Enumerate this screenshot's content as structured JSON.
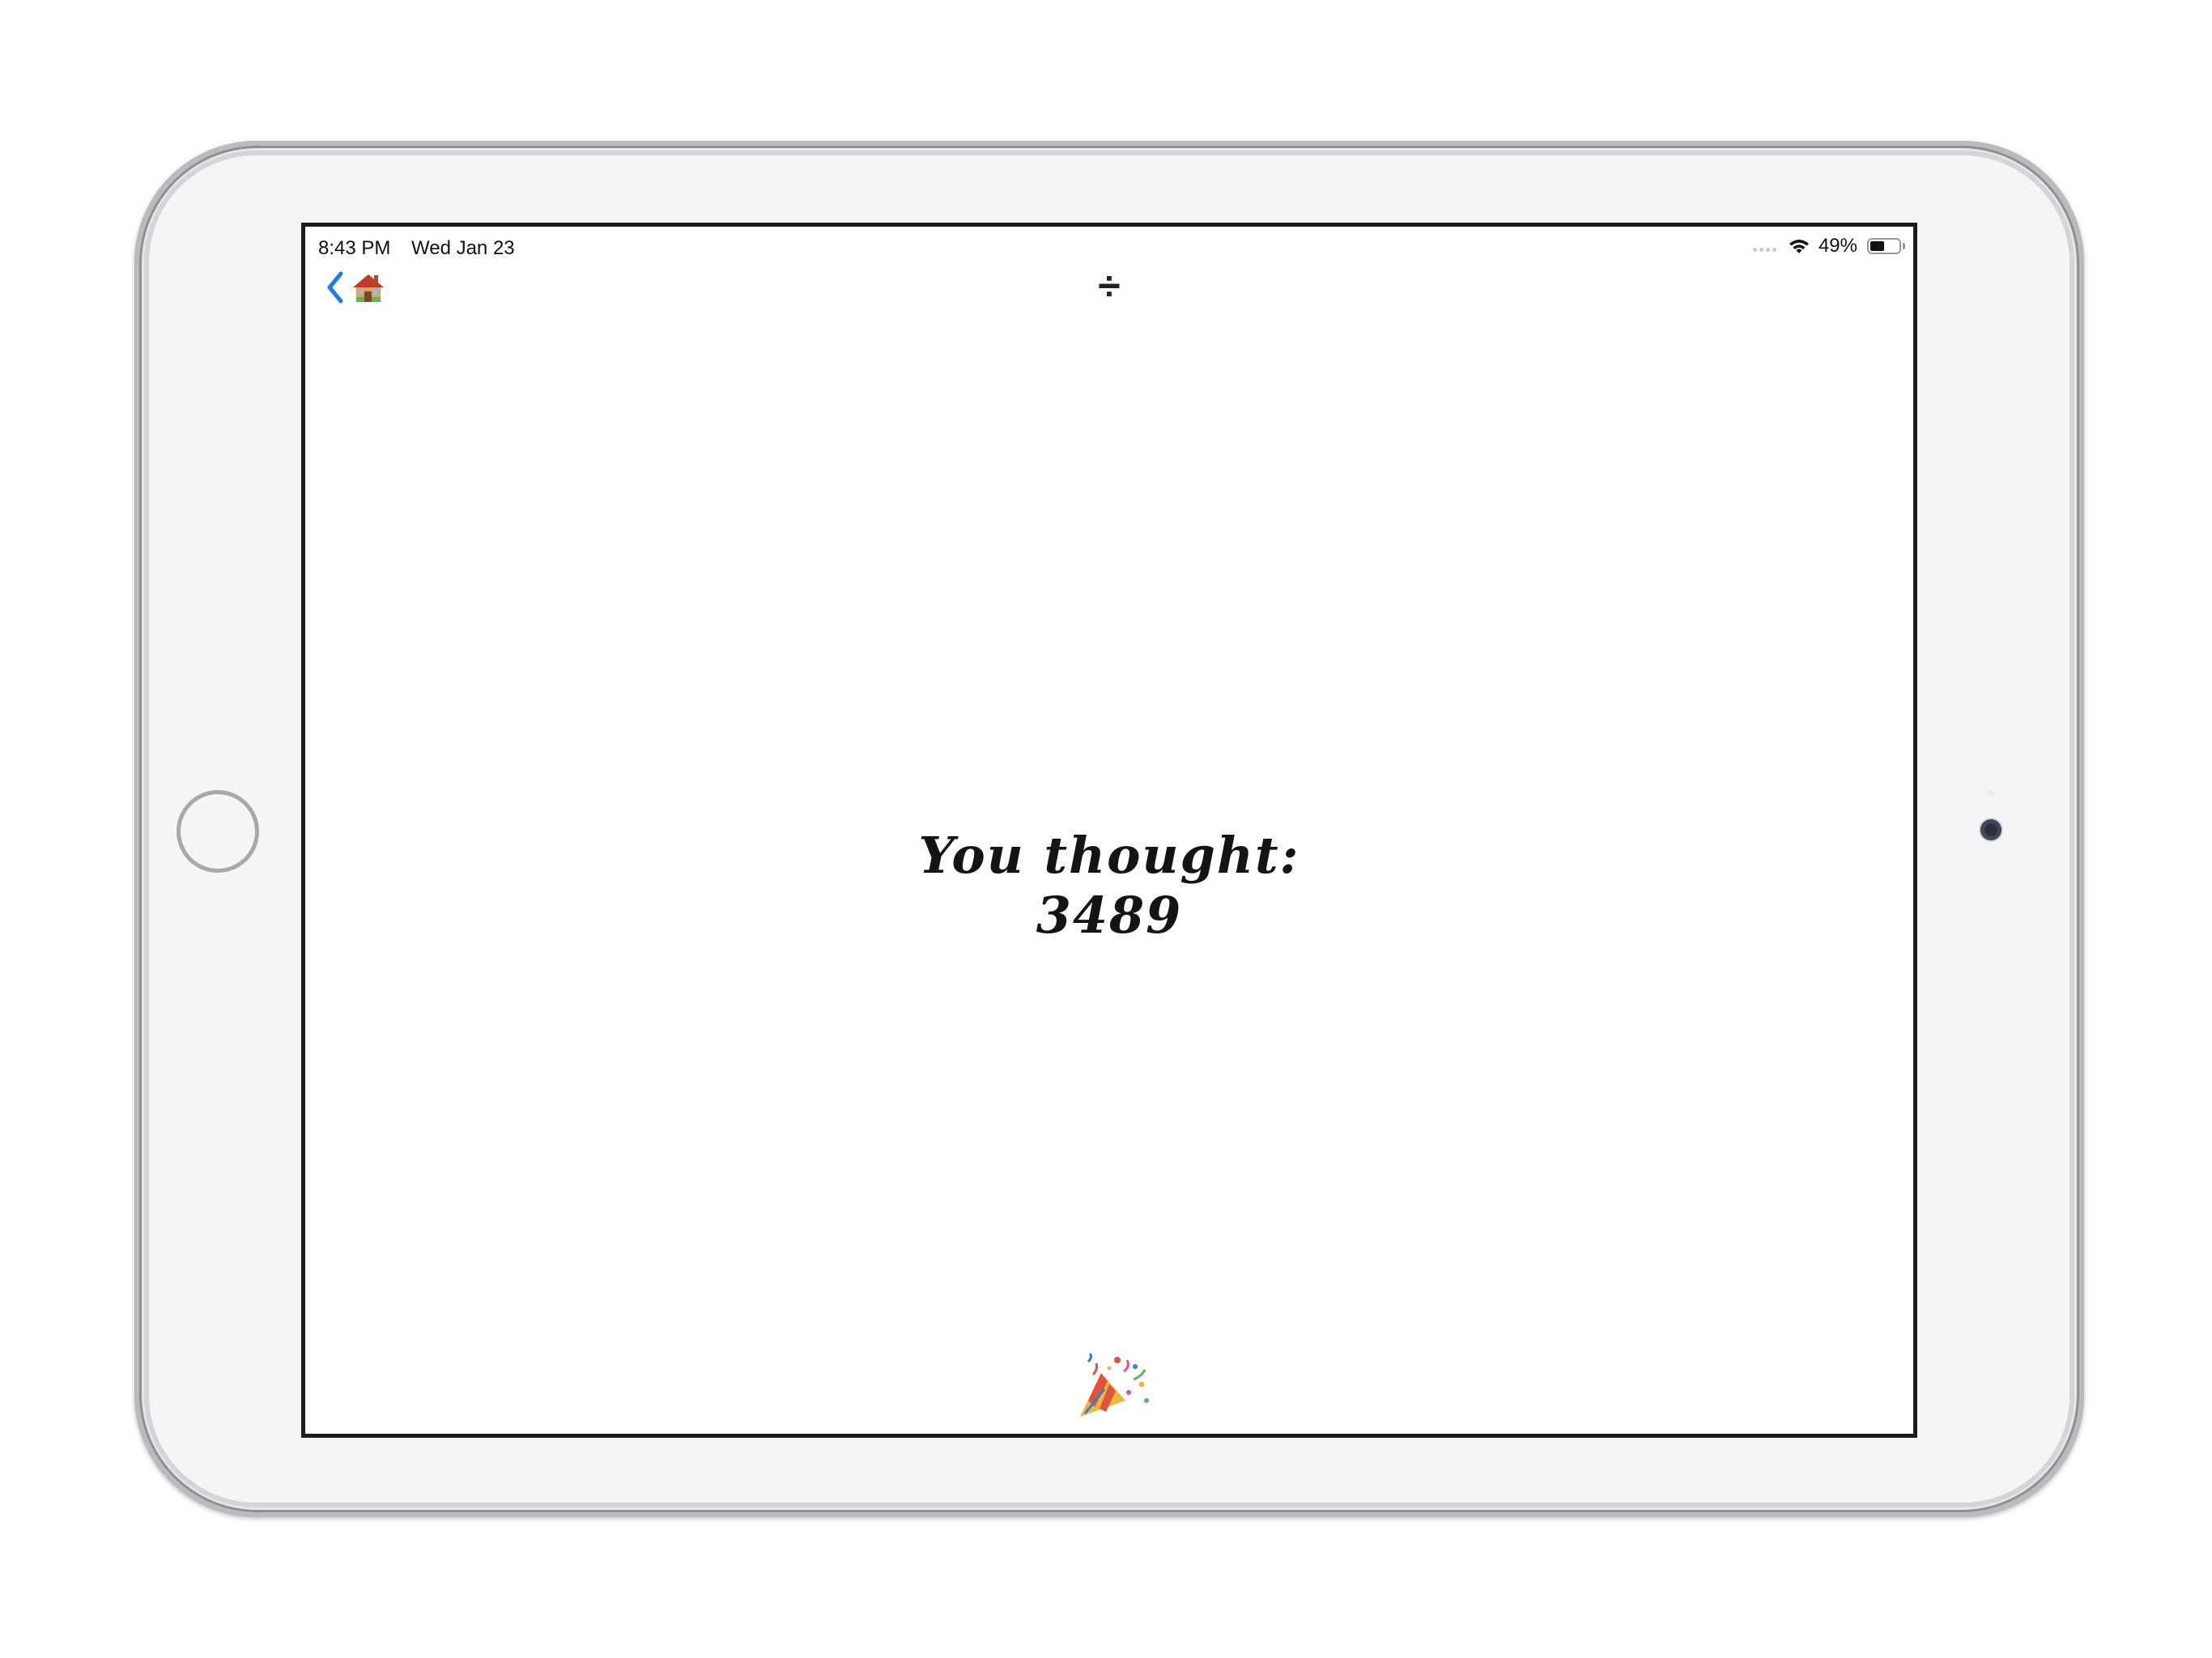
{
  "status_bar": {
    "time": "8:43 PM",
    "date": "Wed Jan 23",
    "battery_percent_label": "49%",
    "battery_level": 0.49,
    "wifi_icon": "wifi-icon",
    "battery_icon": "battery-icon"
  },
  "nav": {
    "back_icon": "chevron-left-icon",
    "home_icon": "house-icon",
    "title": "÷",
    "accent_color": "#1a7cf5"
  },
  "main": {
    "line1": "You thought:",
    "line2": "3489"
  },
  "footer": {
    "party_icon": "party-popper-icon"
  }
}
